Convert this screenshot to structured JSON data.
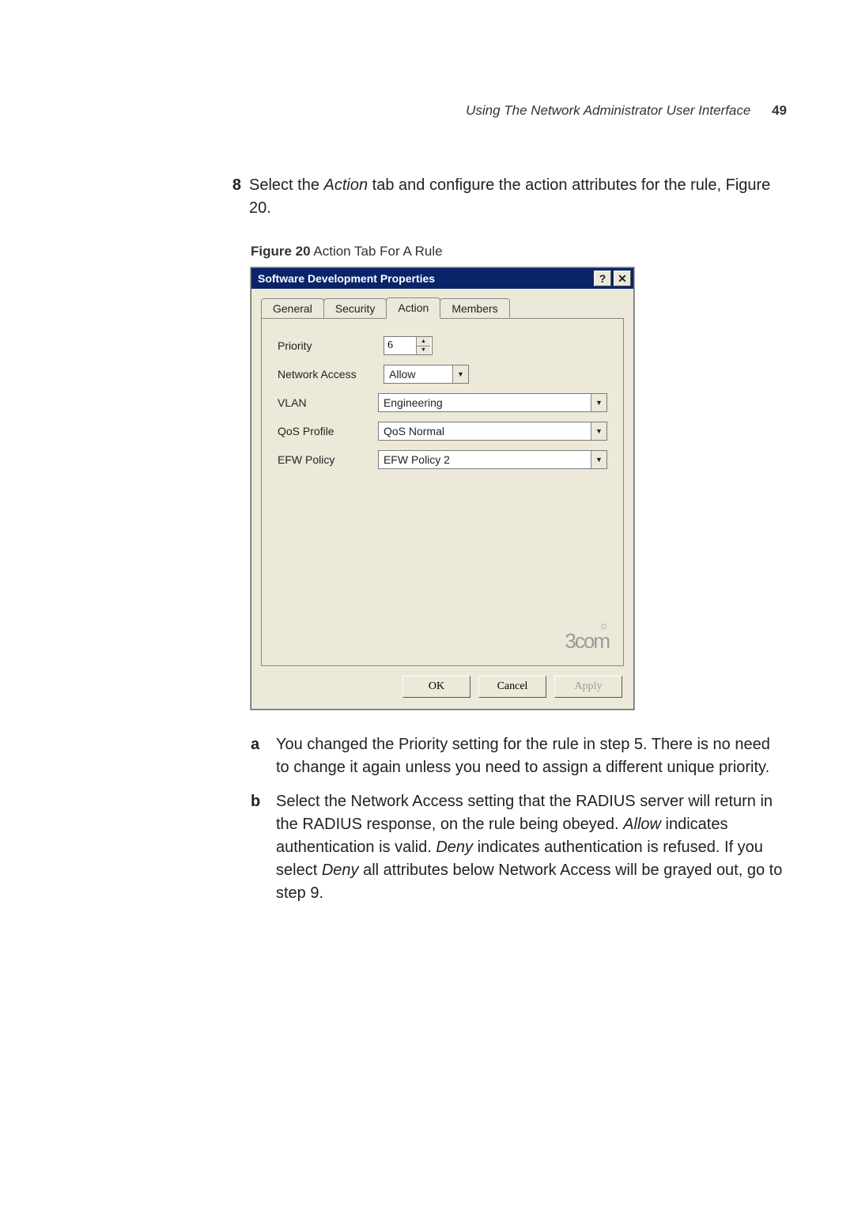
{
  "header": {
    "running_title": "Using The Network Administrator User Interface",
    "page_number": "49"
  },
  "step8": {
    "num": "8",
    "prefix": "Select the ",
    "italic1": "Action",
    "middle": " tab and configure the action attributes for the rule, Figure 20."
  },
  "figure_caption": {
    "label": "Figure 20",
    "text": "   Action Tab For A Rule"
  },
  "dialog": {
    "title": "Software Development Properties",
    "tabs": {
      "general": "General",
      "security": "Security",
      "action": "Action",
      "members": "Members"
    },
    "fields": {
      "priority_label": "Priority",
      "priority_value": "6",
      "network_access_label": "Network Access",
      "network_access_value": "Allow",
      "vlan_label": "VLAN",
      "vlan_value": "Engineering",
      "qos_label": "QoS Profile",
      "qos_value": "QoS Normal",
      "efw_label": "EFW Policy",
      "efw_value": "EFW Policy 2"
    },
    "logo_brand": "3com",
    "buttons": {
      "ok": "OK",
      "cancel": "Cancel",
      "apply": "Apply"
    }
  },
  "substeps": {
    "a": {
      "marker": "a",
      "text": "You changed the Priority setting for the rule in step 5. There is no need to change it again unless you need to assign a different unique priority."
    },
    "b": {
      "marker": "b",
      "t1": "Select the Network Access setting that the RADIUS server will return in the RADIUS response, on the rule being obeyed. ",
      "i1": "Allow",
      "t2": " indicates authentication is valid. ",
      "i2": "Deny",
      "t3": " indicates authentication is refused. If you select ",
      "i3": "Deny",
      "t4": " all attributes below Network Access will be grayed out, go to step 9."
    }
  }
}
